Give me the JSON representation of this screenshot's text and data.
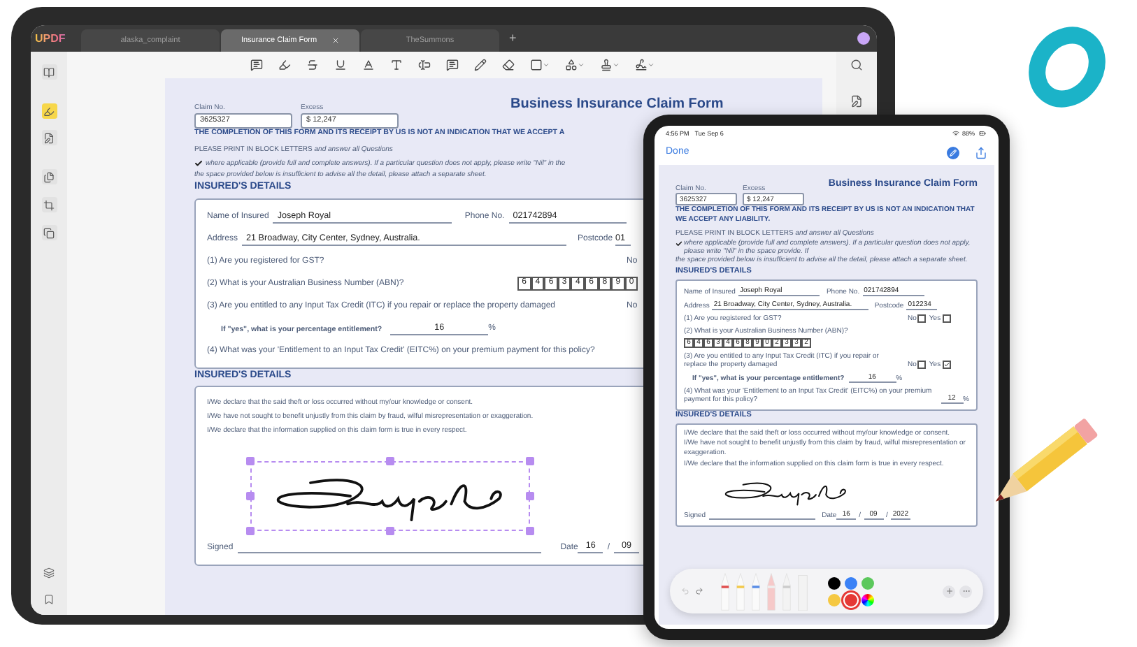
{
  "laptop": {
    "logo": "UPDF",
    "tabs": [
      {
        "label": "alaska_complaint",
        "selected": false
      },
      {
        "label": "Insurance Claim Form",
        "selected": true
      },
      {
        "label": "TheSummons",
        "selected": false
      }
    ],
    "new_tab": "+",
    "sidebar": [
      {
        "selected": false
      },
      {
        "selected": true
      },
      {
        "selected": false
      },
      {
        "selected": false
      },
      {
        "selected": false
      },
      {
        "selected": false
      }
    ],
    "document": {
      "title": "Business Insurance Claim Form",
      "claim_label": "Claim No.",
      "claim_no": "3625327",
      "excess_label": "Excess",
      "excess": "$ 12,247",
      "notice": "THE COMPLETION OF THIS FORM AND ITS RECEIPT BY US IS NOT AN INDICATION THAT WE ACCEPT A",
      "block_letters": "PLEASE PRINT IN BLOCK LETTERS *and answer all Questions*",
      "instructions_checked": true,
      "instruction_1": "where applicable (provide full and complete answers). If a particular question does not apply, please write \"Nil\" in the",
      "instruction_2": "the space provided below is insufficient to advise all the detail, please attach a separate sheet.",
      "section_1": "INSURED'S DETAILS",
      "name_label": "Name of Insured",
      "name": "Joseph Royal",
      "phone_label": "Phone No.",
      "phone": "021742894",
      "address_label": "Address",
      "address": "21 Broadway, City Center, Sydney, Australia.",
      "postcode_label": "Postcode",
      "postcode": "01",
      "questions": [
        {
          "kind": "yes_no",
          "text": "(1) Are you registered for GST?",
          "answers": [
            {
              "label": "No"
            }
          ]
        },
        {
          "kind": "digits",
          "text": "(2) What is your Australian Business Number (ABN)?",
          "digits": [
            "6",
            "4",
            "6",
            "3",
            "4",
            "6",
            "8",
            "9",
            "0"
          ]
        },
        {
          "kind": "yes_no",
          "text": "(3) Are you entitled to any Input Tax Credit (ITC) if you repair or replace the property damaged",
          "answers": [
            {
              "label": "No"
            }
          ],
          "followup": {
            "text": "If \"yes\", what is your percentage entitlement?",
            "value": "16",
            "unit": "%"
          }
        },
        {
          "kind": "value",
          "text": "(4) What was your 'Entitlement to an Input Tax Credit' (EITC%) on your premium payment for this policy?"
        }
      ],
      "section_2": "INSURED'S DETAILS",
      "declarations": [
        "I/We declare that the said theft or loss occurred without my/our knowledge or consent.",
        "I/We have not sought to benefit unjustly from this claim by fraud, wilful misrepresentation or exaggeration.",
        "I/We declare that the information supplied on this claim form is true in every respect."
      ],
      "signature": {
        "selected": true
      },
      "signed_label": "Signed",
      "date_label": "Date",
      "date_parts": [
        {
          "kind": "value",
          "text": "16"
        },
        {
          "kind": "separator",
          "text": "/"
        },
        {
          "kind": "value",
          "text": "09"
        }
      ]
    }
  },
  "tablet": {
    "time": "4:56 PM",
    "date": "Tue Sep 6",
    "battery": "88%",
    "done": "Done",
    "document": {
      "title": "Business Insurance Claim Form",
      "claim_label": "Claim No.",
      "claim_no": "3625327",
      "excess_label": "Excess",
      "excess": "$ 12,247",
      "notice": "THE COMPLETION OF THIS FORM AND ITS RECEIPT BY US IS NOT AN INDICATION THAT WE ACCEPT ANY LIABILITY.",
      "block_letters": "PLEASE PRINT IN BLOCK LETTERS *and answer all Questions*",
      "instructions_checked": true,
      "instruction_1": "where applicable (provide full and complete answers). If a particular question does not apply, please write \"Nil\" in the space provide. If",
      "instruction_2": "the space provided below is insufficient to advise all the detail, please attach a separate sheet.",
      "section_1": "INSURED'S DETAILS",
      "name_label": "Name of Insured",
      "name": "Joseph Royal",
      "phone_label": "Phone No.",
      "phone": "021742894",
      "address_label": "Address",
      "address": "21 Broadway, City Center, Sydney, Australia.",
      "postcode_label": "Postcode",
      "postcode": "012234",
      "questions": [
        {
          "kind": "yes_no",
          "text": "(1) Are you registered for GST?",
          "answers": [
            {
              "label": "No",
              "checked": false
            },
            {
              "label": "Yes",
              "checked": false
            }
          ]
        },
        {
          "kind": "digits",
          "text": "(2) What is your Australian Business Number (ABN)?",
          "digits": [
            "6",
            "4",
            "6",
            "3",
            "4",
            "6",
            "8",
            "9",
            "0",
            "2",
            "3",
            "3",
            "2"
          ]
        },
        {
          "kind": "yes_no",
          "text": "(3) Are you entitled to any Input Tax Credit (ITC) if you repair or replace the property damaged",
          "answers": [
            {
              "label": "No",
              "checked": false
            },
            {
              "label": "Yes",
              "checked": true
            }
          ],
          "followup": {
            "text": "If \"yes\", what is your percentage entitlement?",
            "value": "16",
            "unit": "%"
          }
        },
        {
          "kind": "value",
          "text": "(4) What was your 'Entitlement to an Input Tax Credit' (EITC%) on your premium payment for this policy?",
          "value": "12",
          "unit": "%"
        }
      ],
      "section_2": "INSURED'S DETAILS",
      "declarations": [
        "I/We declare that the said theft or loss occurred without my/our knowledge or consent.",
        "I/We have not sought to benefit unjustly from this claim by fraud, wilful misrepresentation or exaggeration.",
        "I/We declare that the information supplied on this claim form is true in every respect."
      ],
      "signature": {
        "selected": false
      },
      "signed_label": "Signed",
      "date_label": "Date",
      "date_parts": [
        {
          "kind": "value",
          "text": "16"
        },
        {
          "kind": "separator",
          "text": "/"
        },
        {
          "kind": "value",
          "text": "09"
        },
        {
          "kind": "separator",
          "text": "/"
        },
        {
          "kind": "value",
          "text": "2022"
        }
      ]
    },
    "palette": {
      "colors": [
        {
          "kind": "swatch",
          "color": "#000000",
          "selected": false
        },
        {
          "kind": "swatch",
          "color": "#3b82f6",
          "selected": false
        },
        {
          "kind": "swatch",
          "color": "#5cc85c",
          "selected": false
        },
        {
          "kind": "swatch",
          "color": "#f5c842",
          "selected": false
        },
        {
          "kind": "swatch",
          "color": "#e53935",
          "selected": true
        },
        {
          "kind": "picker",
          "selected": false
        }
      ]
    }
  }
}
